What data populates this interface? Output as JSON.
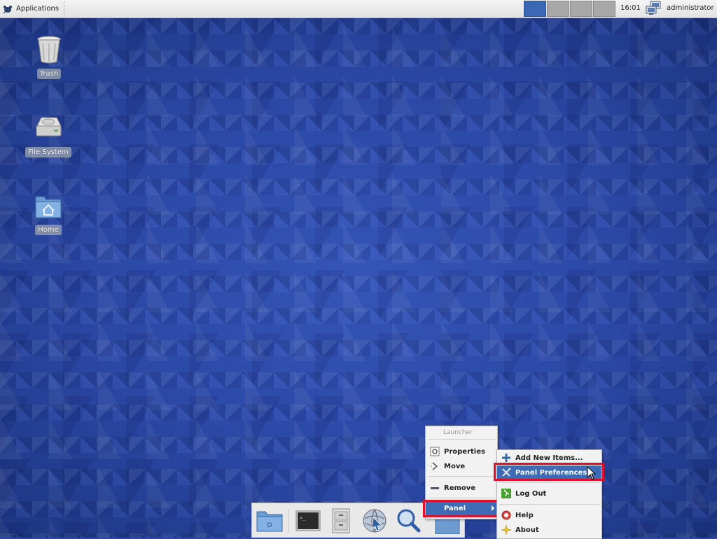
{
  "top_panel": {
    "apps_label": "Applications",
    "clock": "16:01",
    "user": "administrator",
    "workspaces": [
      {
        "icon": "workspace-1",
        "active": true
      },
      {
        "icon": "workspace-2",
        "active": false
      },
      {
        "icon": "workspace-3",
        "active": false
      },
      {
        "icon": "workspace-4",
        "active": false
      }
    ]
  },
  "desktop": {
    "icons": [
      {
        "label": "Trash",
        "icon": "trash-icon"
      },
      {
        "label": "File System",
        "icon": "hard-drive-icon"
      },
      {
        "label": "Home",
        "icon": "home-folder-icon"
      }
    ]
  },
  "dock": {
    "items": [
      "folder-icon",
      "terminal-icon",
      "file-manager-icon",
      "web-browser-icon",
      "search-icon",
      "window-icon"
    ]
  },
  "context_menu": {
    "title": "Launcher",
    "items": {
      "properties": "Properties",
      "move": "Move",
      "remove": "Remove",
      "panel": "Panel"
    }
  },
  "panel_submenu": {
    "items": {
      "add_new_items": "Add New Items...",
      "panel_preferences": "Panel Preferences...",
      "log_out": "Log Out",
      "help": "Help",
      "about": "About"
    }
  },
  "colors": {
    "selection": "#3d6bb6",
    "highlight_box": "#e0102a",
    "wallpaper": "#2c4aa5"
  }
}
